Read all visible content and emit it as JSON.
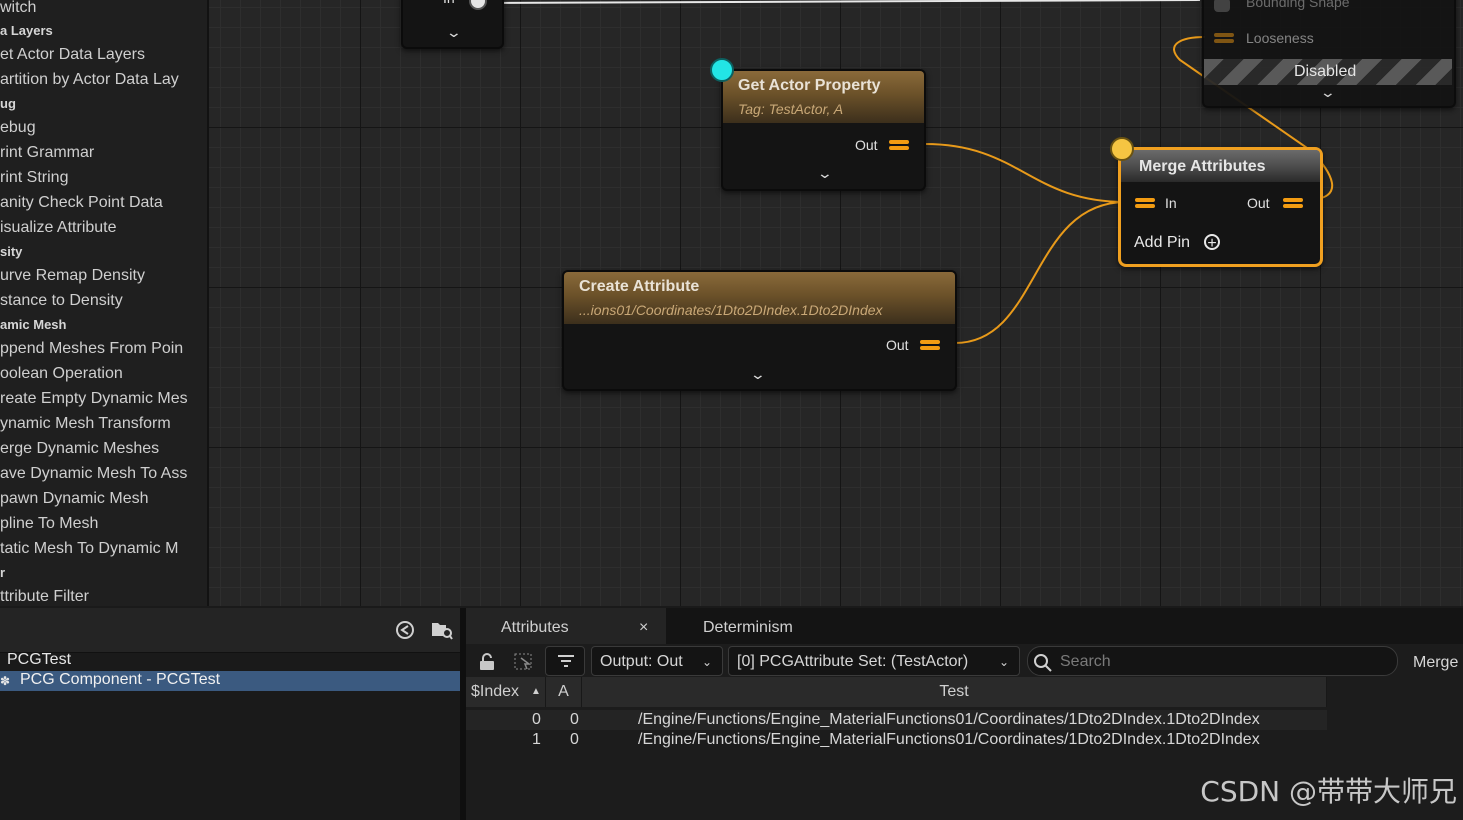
{
  "palette": {
    "items": [
      {
        "label": "witch",
        "cat": false
      },
      {
        "label": "a Layers",
        "cat": true
      },
      {
        "label": "et Actor Data Layers",
        "cat": false
      },
      {
        "label": "artition by Actor Data Lay",
        "cat": false
      },
      {
        "label": "ug",
        "cat": true
      },
      {
        "label": "ebug",
        "cat": false
      },
      {
        "label": "rint Grammar",
        "cat": false
      },
      {
        "label": "rint String",
        "cat": false
      },
      {
        "label": "anity Check Point Data",
        "cat": false
      },
      {
        "label": "isualize Attribute",
        "cat": false
      },
      {
        "label": "sity",
        "cat": true
      },
      {
        "label": "urve Remap Density",
        "cat": false
      },
      {
        "label": "stance to Density",
        "cat": false
      },
      {
        "label": "amic Mesh",
        "cat": true
      },
      {
        "label": "ppend Meshes From Poin",
        "cat": false
      },
      {
        "label": "oolean Operation",
        "cat": false
      },
      {
        "label": "reate Empty Dynamic Mes",
        "cat": false
      },
      {
        "label": "ynamic Mesh Transform",
        "cat": false
      },
      {
        "label": "erge Dynamic Meshes",
        "cat": false
      },
      {
        "label": "ave Dynamic Mesh To Ass",
        "cat": false
      },
      {
        "label": "pawn Dynamic Mesh",
        "cat": false
      },
      {
        "label": "pline To Mesh",
        "cat": false
      },
      {
        "label": "tatic Mesh To Dynamic M",
        "cat": false
      },
      {
        "label": "r",
        "cat": true
      },
      {
        "label": "ttribute Filter",
        "cat": false
      }
    ]
  },
  "graph": {
    "top_node": {
      "pin_label": "In"
    },
    "get_actor_property": {
      "title": "Get Actor Property",
      "subtitle": "Tag: TestActor, A",
      "out_label": "Out"
    },
    "create_attribute": {
      "title": "Create Attribute",
      "subtitle": "...ions01/Coordinates/1Dto2DIndex.1Dto2DIndex",
      "out_label": "Out"
    },
    "merge_attributes": {
      "title": "Merge Attributes",
      "in_label": "In",
      "out_label": "Out",
      "add_pin_label": "Add Pin"
    },
    "right_node": {
      "row1": "Bounding Shape",
      "row2": "Looseness",
      "disabled_label": "Disabled"
    }
  },
  "outliner": {
    "rows": [
      {
        "label": "PCGTest",
        "selected": false
      },
      {
        "label": "PCG Component - PCGTest",
        "selected": true
      }
    ]
  },
  "attributes_panel": {
    "tabs": [
      {
        "label": "Attributes",
        "active": true
      },
      {
        "label": "Determinism",
        "active": false
      }
    ],
    "tab_close": "×",
    "output_select": "Output: Out",
    "set_select": "[0] PCGAttribute Set: (TestActor)",
    "search_placeholder": "Search",
    "merge_label": "Merge",
    "columns": [
      "$Index",
      "A",
      "Test"
    ],
    "rows": [
      {
        "index": "0",
        "a": "0",
        "test": "/Engine/Functions/Engine_MaterialFunctions01/Coordinates/1Dto2DIndex.1Dto2DIndex"
      },
      {
        "index": "1",
        "a": "0",
        "test": "/Engine/Functions/Engine_MaterialFunctions01/Coordinates/1Dto2DIndex.1Dto2DIndex"
      }
    ]
  },
  "watermark": "CSDN @带带大师兄",
  "colors": {
    "accent_orange": "#f39c12",
    "selection_blue": "#3b5a80",
    "exec_cyan": "#22e5e5",
    "exec_yellow": "#f5c542"
  }
}
